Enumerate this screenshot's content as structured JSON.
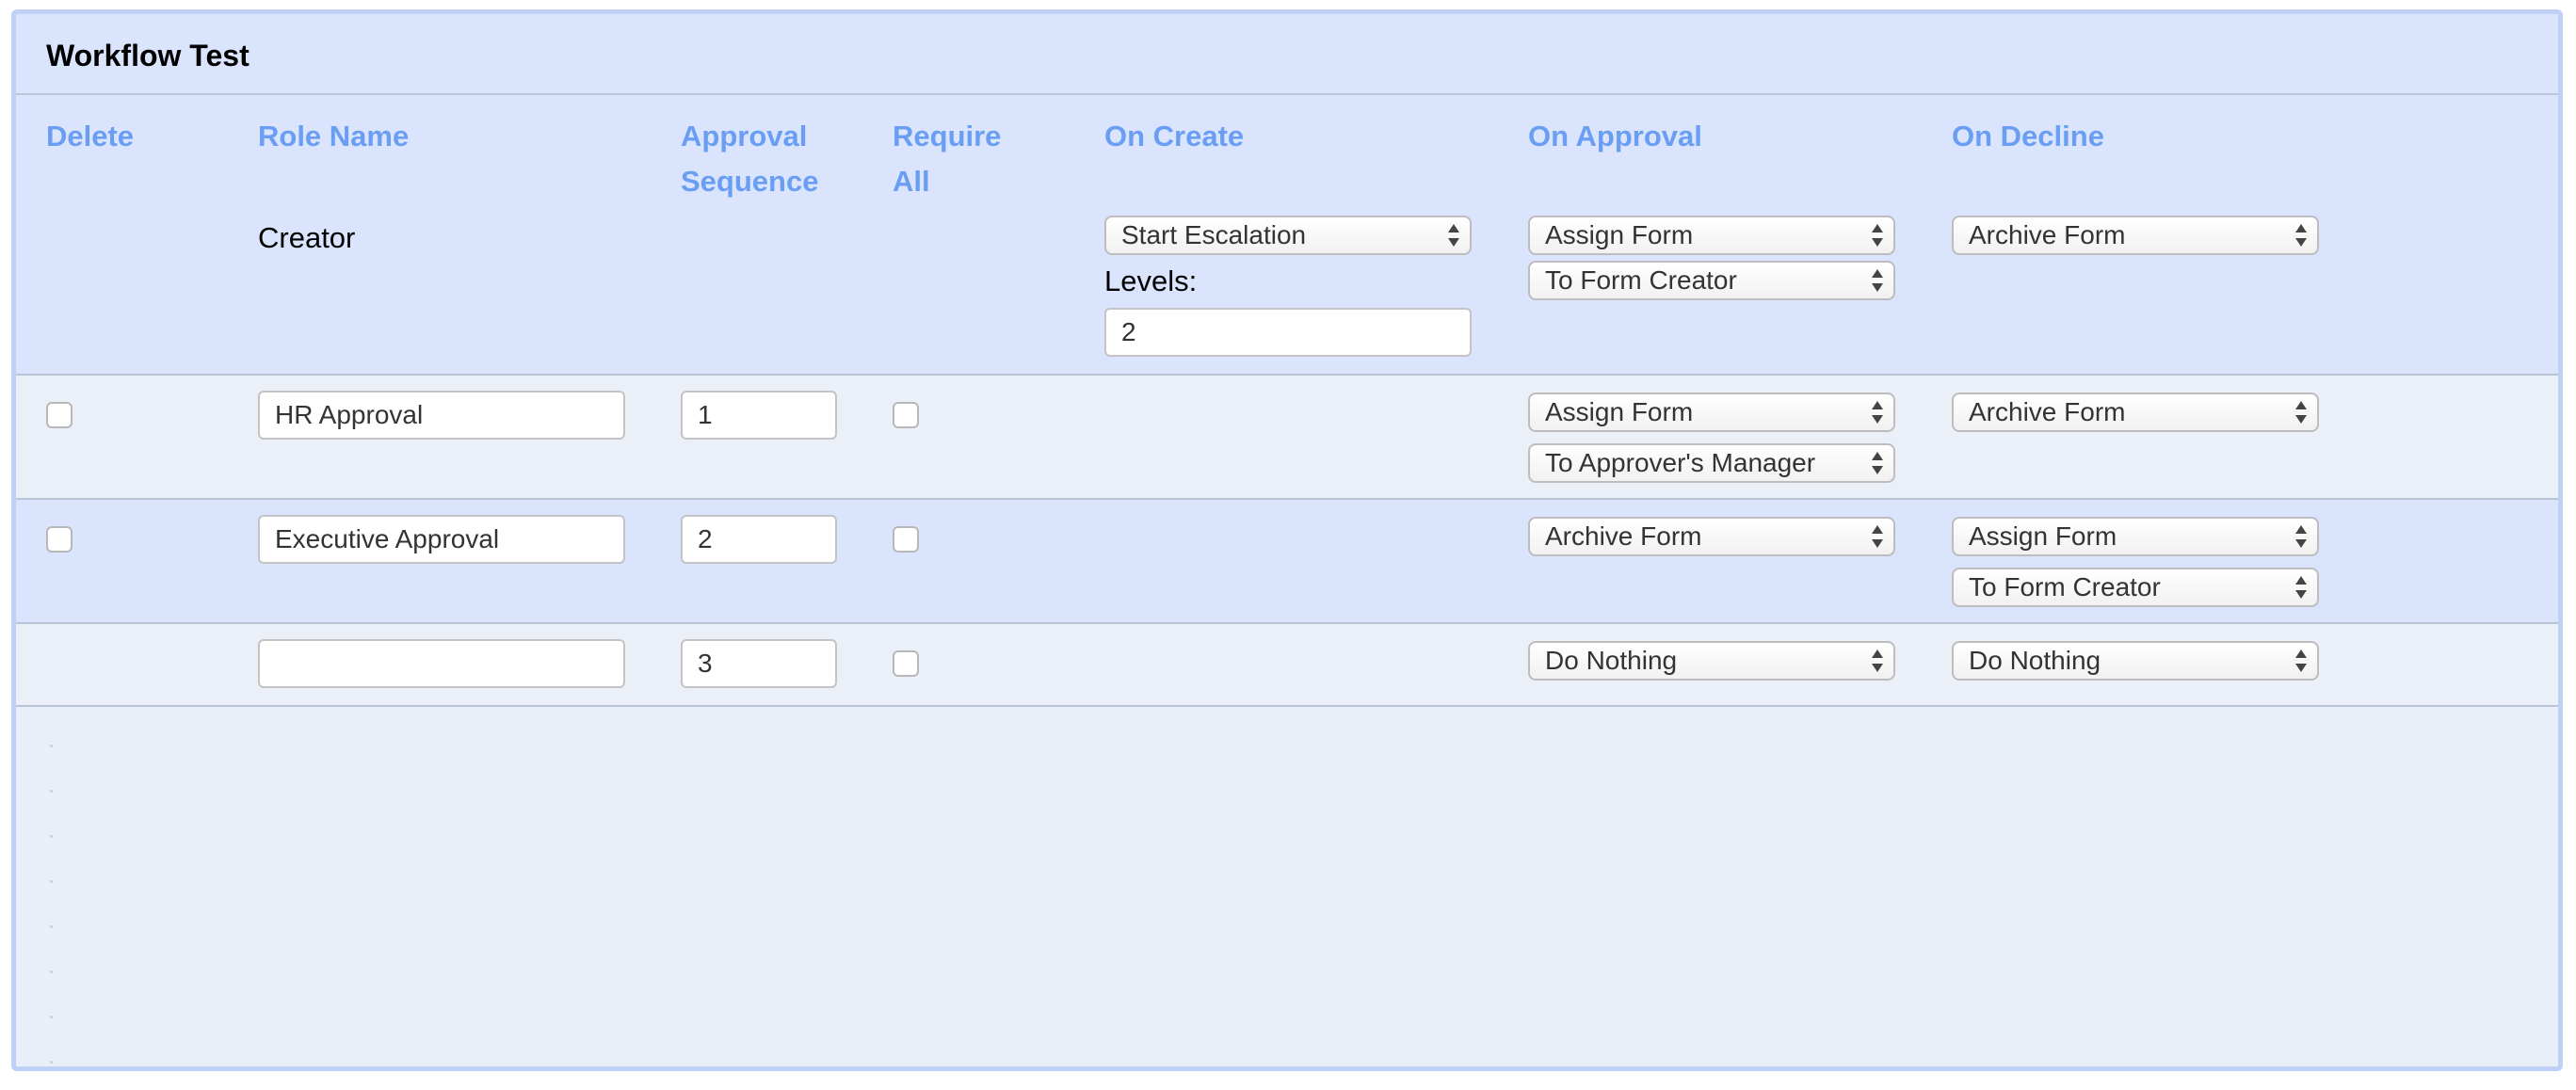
{
  "title": "Workflow Test",
  "columns": {
    "delete": "Delete",
    "role_name": "Role Name",
    "approval_sequence_1": "Approval",
    "approval_sequence_2": "Sequence",
    "require_all_1": "Require",
    "require_all_2": "All",
    "on_create": "On Create",
    "on_approval": "On Approval",
    "on_decline": "On Decline"
  },
  "creator_row": {
    "role_name": "Creator",
    "on_create_action": "Start Escalation",
    "levels_label": "Levels:",
    "levels_value": "2",
    "on_approval_action": "Assign Form",
    "on_approval_target": "To Form Creator",
    "on_decline_action": "Archive Form"
  },
  "rows": [
    {
      "role_name": "HR Approval",
      "sequence": "1",
      "on_approval_action": "Assign Form",
      "on_approval_target": "To Approver's Manager",
      "on_decline_action": "Archive Form"
    },
    {
      "role_name": "Executive Approval",
      "sequence": "2",
      "on_approval_action": "Archive Form",
      "on_decline_action": "Assign Form",
      "on_decline_target": "To Form Creator"
    },
    {
      "role_name": "",
      "sequence": "3",
      "on_approval_action": "Do Nothing",
      "on_decline_action": "Do Nothing"
    }
  ]
}
